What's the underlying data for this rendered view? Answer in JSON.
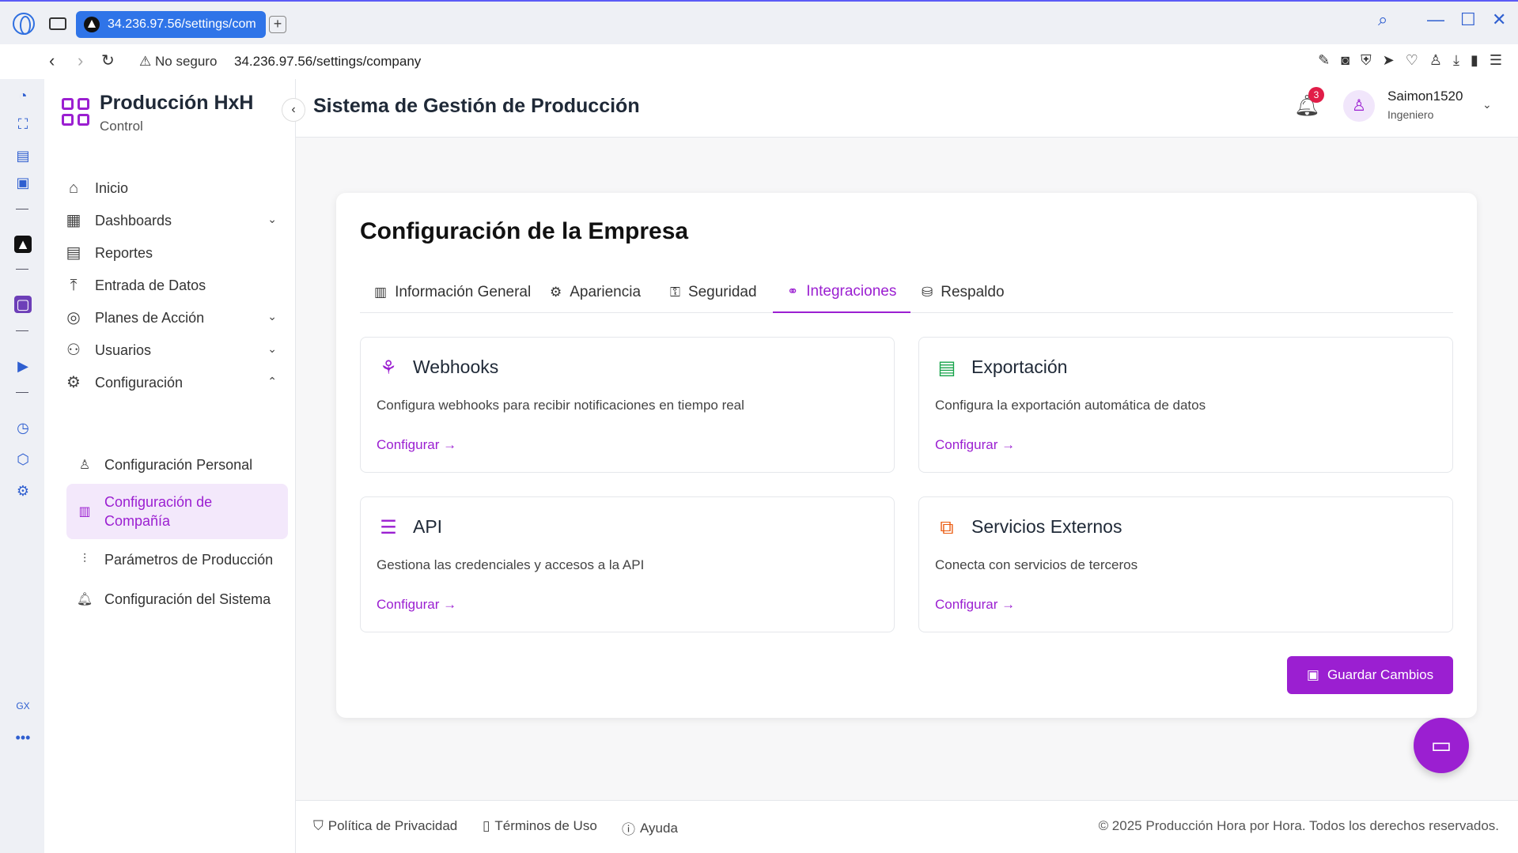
{
  "browser": {
    "tab_title": "34.236.97.56/settings/com",
    "insecure_label": "No seguro",
    "url": "34.236.97.56/settings/company"
  },
  "brand": {
    "title": "Producción HxH",
    "subtitle": "Control"
  },
  "sidebar": {
    "items": [
      {
        "label": "Inicio",
        "icon": "home-icon"
      },
      {
        "label": "Dashboards",
        "icon": "dashboard-icon"
      },
      {
        "label": "Reportes",
        "icon": "report-icon"
      },
      {
        "label": "Entrada de Datos",
        "icon": "upload-icon"
      },
      {
        "label": "Planes de Acción",
        "icon": "target-icon"
      },
      {
        "label": "Usuarios",
        "icon": "users-icon"
      },
      {
        "label": "Configuración",
        "icon": "gear-icon"
      }
    ],
    "sub_items": [
      {
        "label": "Configuración Personal",
        "icon": "user-icon"
      },
      {
        "label": "Configuración de Compañía",
        "icon": "building-icon"
      },
      {
        "label": "Parámetros de Producción",
        "icon": "sliders-icon"
      },
      {
        "label": "Configuración del Sistema",
        "icon": "bell-icon"
      }
    ]
  },
  "header": {
    "title": "Sistema de Gestión de Producción",
    "notification_count": "3",
    "user_name": "Saimon1520",
    "user_role": "Ingeniero"
  },
  "main": {
    "title": "Configuración de la Empresa",
    "tabs": [
      {
        "label": "Información General"
      },
      {
        "label": "Apariencia"
      },
      {
        "label": "Seguridad"
      },
      {
        "label": "Integraciones"
      },
      {
        "label": "Respaldo"
      }
    ],
    "cards": [
      {
        "title": "Webhooks",
        "description": "Configura webhooks para recibir notificaciones en tiempo real",
        "link": "Configurar →",
        "icon": "webhook-icon",
        "color": "#9b1fd1"
      },
      {
        "title": "Exportación",
        "description": "Configura la exportación automática de datos",
        "link": "Configurar →",
        "icon": "spreadsheet-icon",
        "color": "#16a34a"
      },
      {
        "title": "API",
        "description": "Gestiona las credenciales y accesos a la API",
        "link": "Configurar →",
        "icon": "server-icon",
        "color": "#9b1fd1"
      },
      {
        "title": "Servicios Externos",
        "description": "Conecta con servicios de terceros",
        "link": "Configurar →",
        "icon": "network-icon",
        "color": "#ea580c"
      }
    ],
    "save_label": "Guardar Cambios"
  },
  "footer": {
    "privacy": "Política de Privacidad",
    "terms": "Términos de Uso",
    "help": "Ayuda",
    "copyright": "© 2025 Producción Hora por Hora. Todos los derechos reservados."
  },
  "colors": {
    "accent": "#9b1fd1",
    "browser_blue": "#2f74e8"
  }
}
